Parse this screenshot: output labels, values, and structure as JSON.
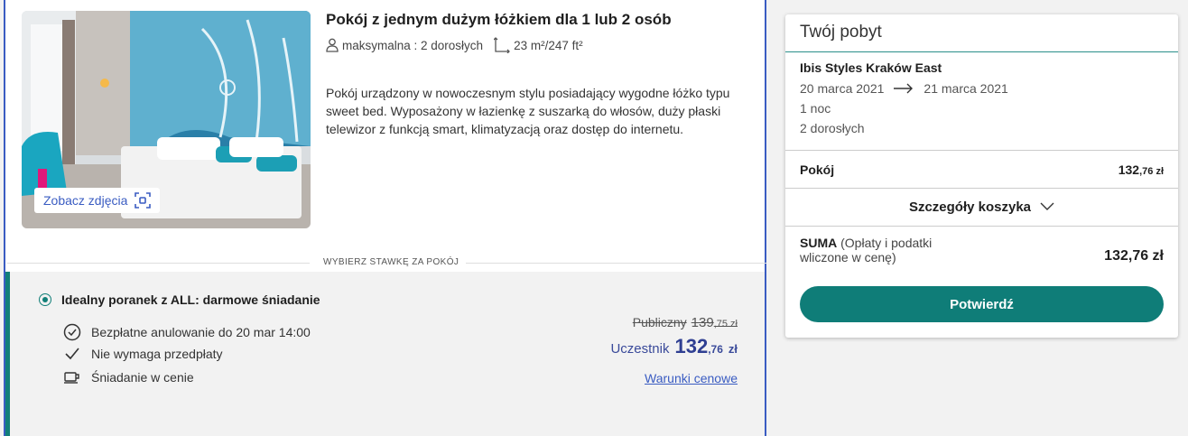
{
  "room": {
    "title": "Pokój z jednym dużym łóżkiem dla 1 lub 2 osób",
    "capacity": "maksymalna : 2 dorosłych",
    "area": "23 m²/247 ft²",
    "description": "Pokój urządzony w nowoczesnym stylu posiadający wygodne łóżko typu sweet bed. Wyposażony w łazienkę z suszarką do włosów, duży płaski telewizor z funkcją smart, klimatyzacją oraz dostęp do internetu.",
    "see_photos": "Zobacz zdjęcia"
  },
  "rate_section_label": "WYBIERZ STAWKĘ ZA POKÓJ",
  "rate": {
    "name": "Idealny poranek z ALL: darmowe śniadanie",
    "features": [
      {
        "icon": "clock-icon",
        "text": "Bezpłatne anulowanie do 20 mar 14:00"
      },
      {
        "icon": "checkmark-icon",
        "text": "Nie wymaga przedpłaty"
      },
      {
        "icon": "coffee-cup-icon",
        "text": "Śniadanie w cenie"
      }
    ],
    "public_label": "Publiczny",
    "public_price_main": "139",
    "public_price_cents": ",75 zł",
    "member_label": "Uczestnik",
    "member_price_main": "132",
    "member_price_cents": ",76",
    "member_currency": "zł",
    "terms_link": "Warunki cenowe"
  },
  "summary": {
    "title": "Twój pobyt",
    "hotel": "Ibis Styles Kraków East",
    "checkin": "20 marca 2021",
    "checkout": "21 marca 2021",
    "nights": "1 noc",
    "guests": "2 dorosłych",
    "room_label": "Pokój",
    "room_price_main": "132",
    "room_price_cents": ",76 zł",
    "cart_details": "Szczegóły koszyka",
    "total_label": "SUMA",
    "total_note": "(Opłaty i podatki wliczone w cenę)",
    "total_amount": "132,76 zł",
    "confirm": "Potwierdź"
  },
  "colors": {
    "accent_teal": "#0f7d78",
    "link_blue": "#3a5cc2",
    "member_price": "#2f3f92"
  }
}
